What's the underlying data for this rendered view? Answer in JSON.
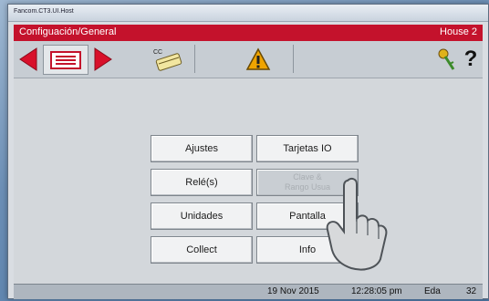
{
  "window": {
    "title": "Fancom.CT3.UI.Host"
  },
  "header": {
    "title": "Configuación/General",
    "house": "House 2"
  },
  "toolbar": {
    "cc_label": "CC",
    "help_label": "?"
  },
  "menu": {
    "ajustes": "Ajustes",
    "tarjetas": "Tarjetas IO",
    "reles": "Relé(s)",
    "clave": "Clave &\nRango Usua",
    "unidades": "Unidades",
    "pantalla": "Pantalla",
    "collect": "Collect",
    "info": "Info"
  },
  "status": {
    "date": "19 Nov 2015",
    "time": "12:28:05 pm",
    "user": "Eda",
    "number": "32"
  },
  "colors": {
    "header": "#c4122c",
    "arrow": "#d8102a",
    "warning": "#f0a400"
  }
}
